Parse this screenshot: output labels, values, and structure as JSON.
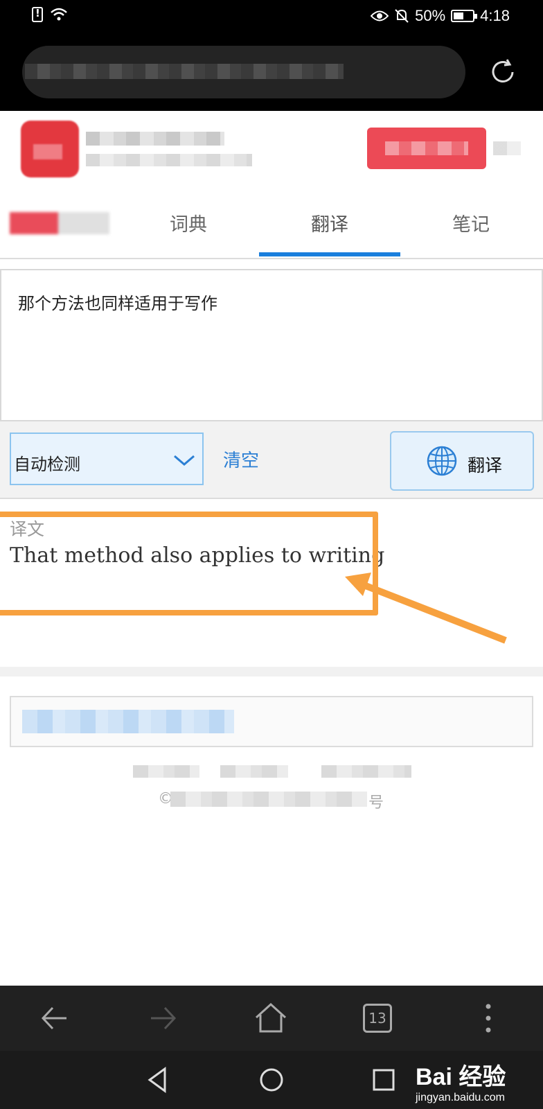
{
  "status_bar": {
    "battery": "50%",
    "time": "4:18"
  },
  "tabs": [
    {
      "label": "词典",
      "active": false
    },
    {
      "label": "翻译",
      "active": true
    },
    {
      "label": "笔记",
      "active": false
    }
  ],
  "input": {
    "text": "那个方法也同样适用于写作"
  },
  "controls": {
    "language_select": "自动检测",
    "clear_label": "清空",
    "translate_label": "翻译"
  },
  "result": {
    "heading": "译文",
    "output": "That method also applies to writing"
  },
  "footer": {
    "copyright_symbol": "©",
    "record_suffix": "号"
  },
  "toolbar": {
    "tab_count": "13"
  },
  "watermark": {
    "brand": "Bai 经验",
    "domain": "jingyan.baidu.com"
  },
  "colors": {
    "tab_active_underline": "#1a7fdd",
    "link_blue": "#2b7fd4",
    "annotation_orange": "#f7a13f",
    "brand_red": "#e3383f"
  }
}
